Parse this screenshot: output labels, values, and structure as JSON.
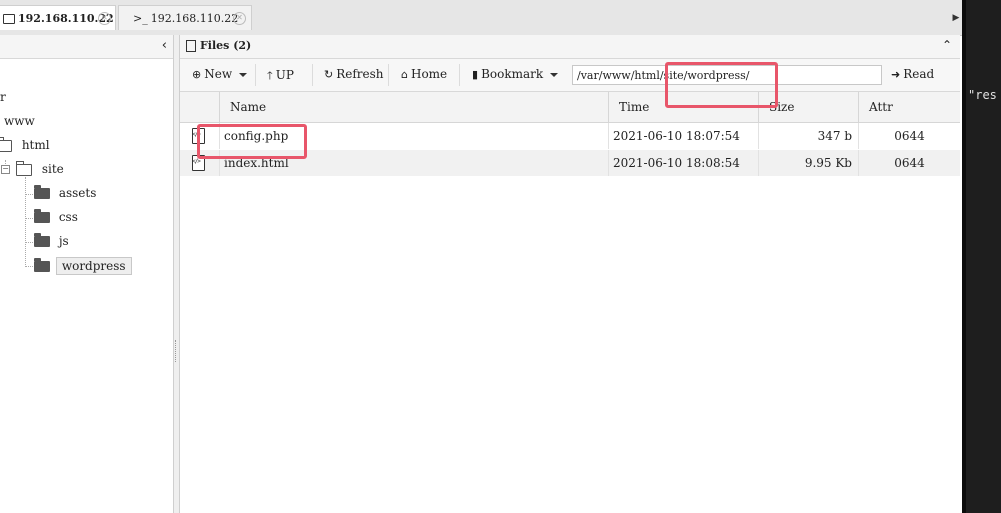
{
  "tabs": [
    {
      "label": "192.168.110.22",
      "active": true
    },
    {
      "label": "192.168.110.22",
      "prefix": ">_",
      "active": false
    }
  ],
  "terminal": {
    "text": "\"res"
  },
  "tree": {
    "nodes": [
      {
        "label": "r"
      },
      {
        "label": "www"
      },
      {
        "label": "html"
      },
      {
        "label": "site"
      },
      {
        "label": "assets"
      },
      {
        "label": "css"
      },
      {
        "label": "js"
      },
      {
        "label": "wordpress",
        "selected": true
      }
    ]
  },
  "files": {
    "title": "Files (2)",
    "toolbar": {
      "new": "New",
      "up": "UP",
      "refresh": "Refresh",
      "home": "Home",
      "bookmark": "Bookmark",
      "path": "/var/www/html/site/wordpress/",
      "read": "Read"
    },
    "columns": {
      "name": "Name",
      "time": "Time",
      "size": "Size",
      "attr": "Attr"
    },
    "rows": [
      {
        "name": "config.php",
        "time": "2021-06-10 18:07:54",
        "size": "347 b",
        "attr": "0644"
      },
      {
        "name": "index.html",
        "time": "2021-06-10 18:08:54",
        "size": "9.95 Kb",
        "attr": "0644"
      }
    ]
  },
  "icons": {
    "tab_folder": "folder-icon",
    "tab_terminal": "terminal-icon",
    "close": "close-icon",
    "collapse_left": "chevron-left-icon",
    "collapse_up": "chevron-up-icon",
    "new": "plus-circle-icon",
    "up": "arrow-up-icon",
    "refresh": "refresh-icon",
    "home": "home-icon",
    "bookmark": "bookmark-icon",
    "read": "arrow-right-icon",
    "file": "code-file-icon"
  },
  "colors": {
    "annotation": "#e8566a",
    "terminal_bg": "#1e1e1e"
  }
}
